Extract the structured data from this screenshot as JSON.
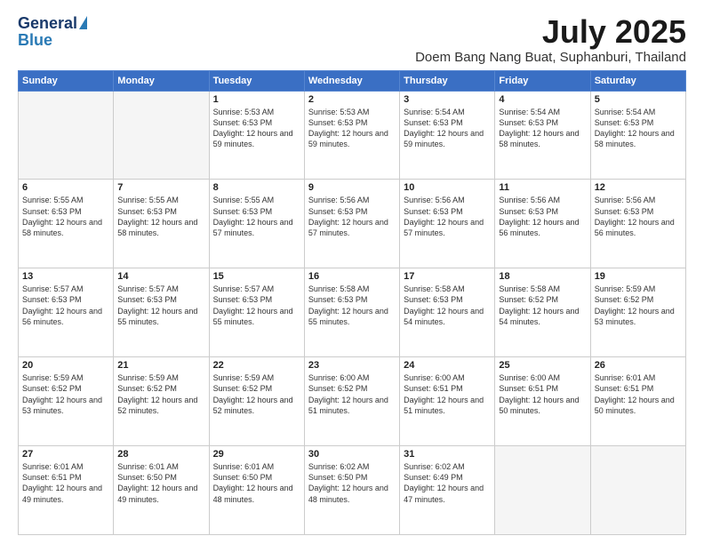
{
  "header": {
    "logo_line1": "General",
    "logo_line2": "Blue",
    "month": "July 2025",
    "location": "Doem Bang Nang Buat, Suphanburi, Thailand"
  },
  "weekdays": [
    "Sunday",
    "Monday",
    "Tuesday",
    "Wednesday",
    "Thursday",
    "Friday",
    "Saturday"
  ],
  "weeks": [
    [
      {
        "day": "",
        "empty": true
      },
      {
        "day": "",
        "empty": true
      },
      {
        "day": "1",
        "sunrise": "5:53 AM",
        "sunset": "6:53 PM",
        "daylight": "12 hours and 59 minutes."
      },
      {
        "day": "2",
        "sunrise": "5:53 AM",
        "sunset": "6:53 PM",
        "daylight": "12 hours and 59 minutes."
      },
      {
        "day": "3",
        "sunrise": "5:54 AM",
        "sunset": "6:53 PM",
        "daylight": "12 hours and 59 minutes."
      },
      {
        "day": "4",
        "sunrise": "5:54 AM",
        "sunset": "6:53 PM",
        "daylight": "12 hours and 58 minutes."
      },
      {
        "day": "5",
        "sunrise": "5:54 AM",
        "sunset": "6:53 PM",
        "daylight": "12 hours and 58 minutes."
      }
    ],
    [
      {
        "day": "6",
        "sunrise": "5:55 AM",
        "sunset": "6:53 PM",
        "daylight": "12 hours and 58 minutes."
      },
      {
        "day": "7",
        "sunrise": "5:55 AM",
        "sunset": "6:53 PM",
        "daylight": "12 hours and 58 minutes."
      },
      {
        "day": "8",
        "sunrise": "5:55 AM",
        "sunset": "6:53 PM",
        "daylight": "12 hours and 57 minutes."
      },
      {
        "day": "9",
        "sunrise": "5:56 AM",
        "sunset": "6:53 PM",
        "daylight": "12 hours and 57 minutes."
      },
      {
        "day": "10",
        "sunrise": "5:56 AM",
        "sunset": "6:53 PM",
        "daylight": "12 hours and 57 minutes."
      },
      {
        "day": "11",
        "sunrise": "5:56 AM",
        "sunset": "6:53 PM",
        "daylight": "12 hours and 56 minutes."
      },
      {
        "day": "12",
        "sunrise": "5:56 AM",
        "sunset": "6:53 PM",
        "daylight": "12 hours and 56 minutes."
      }
    ],
    [
      {
        "day": "13",
        "sunrise": "5:57 AM",
        "sunset": "6:53 PM",
        "daylight": "12 hours and 56 minutes."
      },
      {
        "day": "14",
        "sunrise": "5:57 AM",
        "sunset": "6:53 PM",
        "daylight": "12 hours and 55 minutes."
      },
      {
        "day": "15",
        "sunrise": "5:57 AM",
        "sunset": "6:53 PM",
        "daylight": "12 hours and 55 minutes."
      },
      {
        "day": "16",
        "sunrise": "5:58 AM",
        "sunset": "6:53 PM",
        "daylight": "12 hours and 55 minutes."
      },
      {
        "day": "17",
        "sunrise": "5:58 AM",
        "sunset": "6:53 PM",
        "daylight": "12 hours and 54 minutes."
      },
      {
        "day": "18",
        "sunrise": "5:58 AM",
        "sunset": "6:52 PM",
        "daylight": "12 hours and 54 minutes."
      },
      {
        "day": "19",
        "sunrise": "5:59 AM",
        "sunset": "6:52 PM",
        "daylight": "12 hours and 53 minutes."
      }
    ],
    [
      {
        "day": "20",
        "sunrise": "5:59 AM",
        "sunset": "6:52 PM",
        "daylight": "12 hours and 53 minutes."
      },
      {
        "day": "21",
        "sunrise": "5:59 AM",
        "sunset": "6:52 PM",
        "daylight": "12 hours and 52 minutes."
      },
      {
        "day": "22",
        "sunrise": "5:59 AM",
        "sunset": "6:52 PM",
        "daylight": "12 hours and 52 minutes."
      },
      {
        "day": "23",
        "sunrise": "6:00 AM",
        "sunset": "6:52 PM",
        "daylight": "12 hours and 51 minutes."
      },
      {
        "day": "24",
        "sunrise": "6:00 AM",
        "sunset": "6:51 PM",
        "daylight": "12 hours and 51 minutes."
      },
      {
        "day": "25",
        "sunrise": "6:00 AM",
        "sunset": "6:51 PM",
        "daylight": "12 hours and 50 minutes."
      },
      {
        "day": "26",
        "sunrise": "6:01 AM",
        "sunset": "6:51 PM",
        "daylight": "12 hours and 50 minutes."
      }
    ],
    [
      {
        "day": "27",
        "sunrise": "6:01 AM",
        "sunset": "6:51 PM",
        "daylight": "12 hours and 49 minutes."
      },
      {
        "day": "28",
        "sunrise": "6:01 AM",
        "sunset": "6:50 PM",
        "daylight": "12 hours and 49 minutes."
      },
      {
        "day": "29",
        "sunrise": "6:01 AM",
        "sunset": "6:50 PM",
        "daylight": "12 hours and 48 minutes."
      },
      {
        "day": "30",
        "sunrise": "6:02 AM",
        "sunset": "6:50 PM",
        "daylight": "12 hours and 48 minutes."
      },
      {
        "day": "31",
        "sunrise": "6:02 AM",
        "sunset": "6:49 PM",
        "daylight": "12 hours and 47 minutes."
      },
      {
        "day": "",
        "empty": true
      },
      {
        "day": "",
        "empty": true
      }
    ]
  ],
  "labels": {
    "sunrise": "Sunrise:",
    "sunset": "Sunset:",
    "daylight": "Daylight:"
  }
}
